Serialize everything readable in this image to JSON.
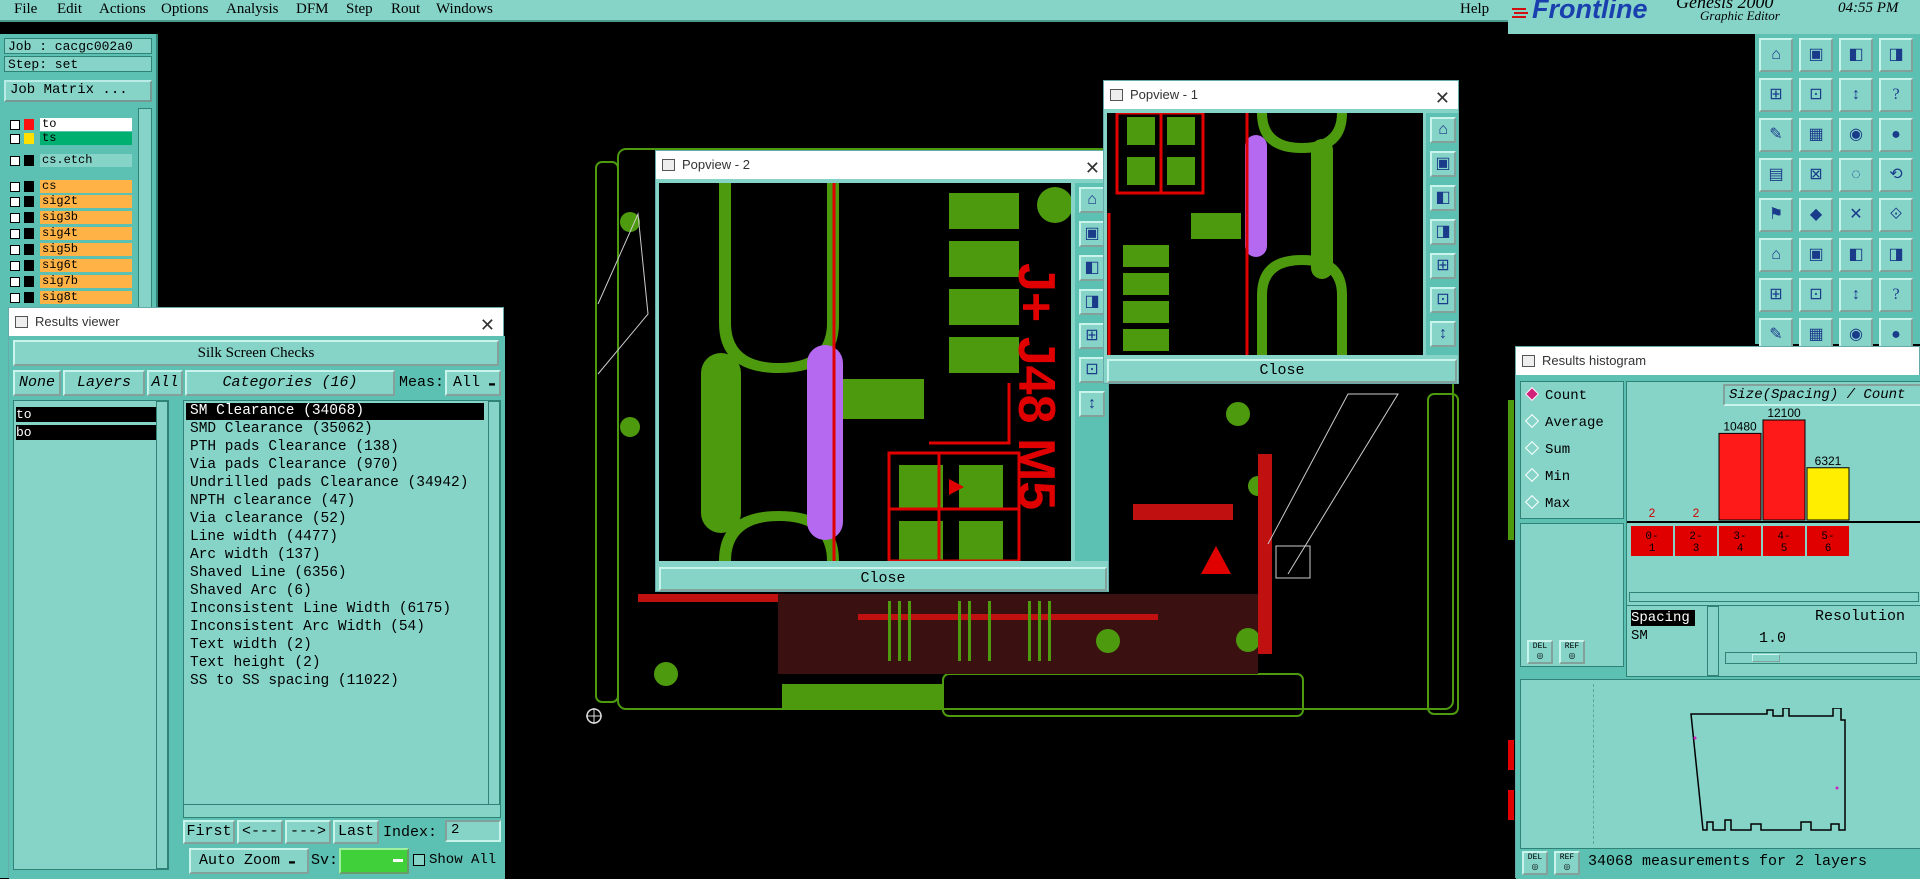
{
  "menu": {
    "items": [
      "File",
      "Edit",
      "Actions",
      "Options",
      "Analysis",
      "DFM",
      "Step",
      "Rout",
      "Windows"
    ],
    "help": "Help"
  },
  "brand": {
    "logo": "Frontline",
    "product": "Genesis 2000",
    "subtitle": "Graphic Editor",
    "time": "04:55 PM"
  },
  "job": {
    "job_label": "Job : cacgc002a0",
    "step_label": "Step: set",
    "job_matrix": "Job Matrix ..."
  },
  "layers": [
    {
      "name": "to",
      "color": "#ff1010",
      "bg": "#ffffff"
    },
    {
      "name": "ts",
      "color": "#ffe000",
      "bg": "#00b070"
    },
    {
      "name": "cs.etch",
      "color": "#000000",
      "bg": "#86d4c8"
    },
    {
      "name": "cs",
      "color": "#000000",
      "bg": "#ffb347"
    },
    {
      "name": "sig2t",
      "color": "#000000",
      "bg": "#ffb347"
    },
    {
      "name": "sig3b",
      "color": "#000000",
      "bg": "#ffb347"
    },
    {
      "name": "sig4t",
      "color": "#000000",
      "bg": "#ffb347"
    },
    {
      "name": "sig5b",
      "color": "#000000",
      "bg": "#ffb347"
    },
    {
      "name": "sig6t",
      "color": "#000000",
      "bg": "#ffb347"
    },
    {
      "name": "sig7b",
      "color": "#000000",
      "bg": "#ffb347"
    },
    {
      "name": "sig8t",
      "color": "#000000",
      "bg": "#ffb347"
    }
  ],
  "results_viewer": {
    "title": "Results viewer",
    "heading": "Silk Screen Checks",
    "none": "None",
    "layers": "Layers",
    "all": "All",
    "categories_label": "Categories (16)",
    "meas_label": "Meas:",
    "meas_value": "All",
    "layer_list": [
      "to",
      "bo"
    ],
    "categories": [
      "SM Clearance (34068)",
      "SMD Clearance (35062)",
      "PTH pads Clearance (138)",
      "Via pads Clearance (970)",
      "Undrilled pads Clearance (34942)",
      "NPTH clearance (47)",
      "Via clearance (52)",
      "Line width (4477)",
      "Arc width (137)",
      "Shaved Line (6356)",
      "Shaved Arc (6)",
      "Inconsistent Line Width (6175)",
      "Inconsistent Arc Width (54)",
      "Text width (2)",
      "Text height (2)",
      "SS to SS spacing (11022)"
    ],
    "first": "First",
    "prev": "<---",
    "next": "--->",
    "last": "Last",
    "index_label": "Index:",
    "index_value": "2",
    "auto_zoom": "Auto Zoom",
    "sv_label": "Sv:",
    "show_all": "Show All"
  },
  "popview2": {
    "title": "Popview - 2",
    "close": "Close",
    "silk_text": "J+ J48 M5"
  },
  "popview1": {
    "title": "Popview - 1",
    "close": "Close"
  },
  "histogram": {
    "title": "Results histogram",
    "modes": [
      "Count",
      "Average",
      "Sum",
      "Min",
      "Max"
    ],
    "selected_mode": "Count",
    "header": "Size(Spacing) / Count",
    "del": "DEL",
    "ref": "REF",
    "spacing_label": "Spacing",
    "sm_label": "SM",
    "resolution_label": "Resolution",
    "resolution_value": "1.0",
    "status": "34068 measurements for 2 layers"
  },
  "chart_data": {
    "type": "bar",
    "title": "Size(Spacing) / Count",
    "categories": [
      "0-1",
      "2-3",
      "3-4",
      "4-5",
      "5-6"
    ],
    "values": [
      2,
      2,
      10480,
      12100,
      6321
    ],
    "value_labels": [
      "2",
      "2",
      "10480",
      "12100",
      "6321"
    ],
    "colors": [
      "#e00000",
      "#e00000",
      "#ff1a1a",
      "#ff1a1a",
      "#ffee00"
    ],
    "ylim": [
      0,
      12100
    ]
  }
}
